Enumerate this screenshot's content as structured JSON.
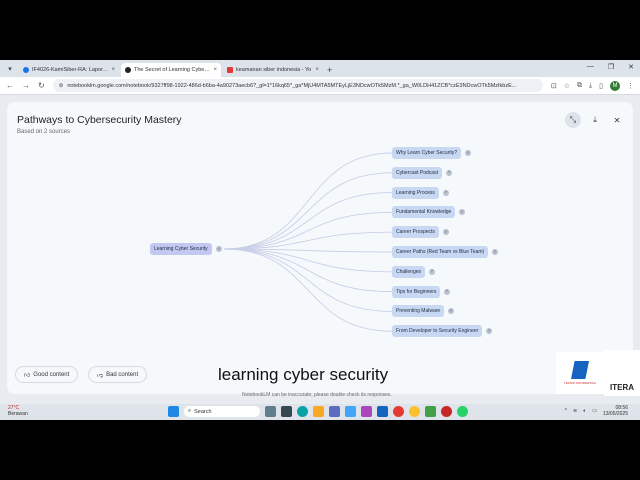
{
  "browser": {
    "tabs": [
      {
        "label": "IF4026-KamiSiber-RA: Laporan",
        "active": false,
        "color": "#1a73e8"
      },
      {
        "label": "The Secret of Learning Cyber S",
        "active": true,
        "color": "#222222"
      },
      {
        "label": "keamanan siber indonesia - Yo",
        "active": false,
        "color": "#e53935"
      }
    ],
    "new_tab": "+",
    "url": "notebooklm.google.com/notebook/9327ff98-1922-486d-b6ba-4a90273aecb6?_gl=1*16kq65*_ga*MjU4MTA5MTEyLjE3NDcwOTk5MzM.*_ga_W0LDH41ZCB*czE3NDcwOTk5MzIkbzE..."
  },
  "dialog": {
    "title": "Pathways to Cybersecurity Mastery",
    "subtitle": "Based on 2 sources"
  },
  "mindmap": {
    "root": "Learning Cyber Security",
    "children": [
      "Why Learn Cyber Security?",
      "Cybercast Podcast",
      "Learning Process",
      "Fundamental Knowledge",
      "Career Prospects",
      "Career Paths (Red Team vs Blue Team)",
      "Challenges",
      "Tips for Beginners",
      "Preventing Malware",
      "From Developer to Security Engineer"
    ]
  },
  "feedback": {
    "good": "Good content",
    "bad": "Bad content"
  },
  "caption": "learning cyber security",
  "disclaimer": "NotebookLM can be inaccurate; please double check its responses.",
  "logo": {
    "text": "TEKNIK INFORMATIKA",
    "second": "ITERA"
  },
  "taskbar": {
    "temperature": "27°C",
    "weather": "Berawan",
    "search_placeholder": "Search",
    "time": "08:56",
    "date": "13/05/2025"
  }
}
